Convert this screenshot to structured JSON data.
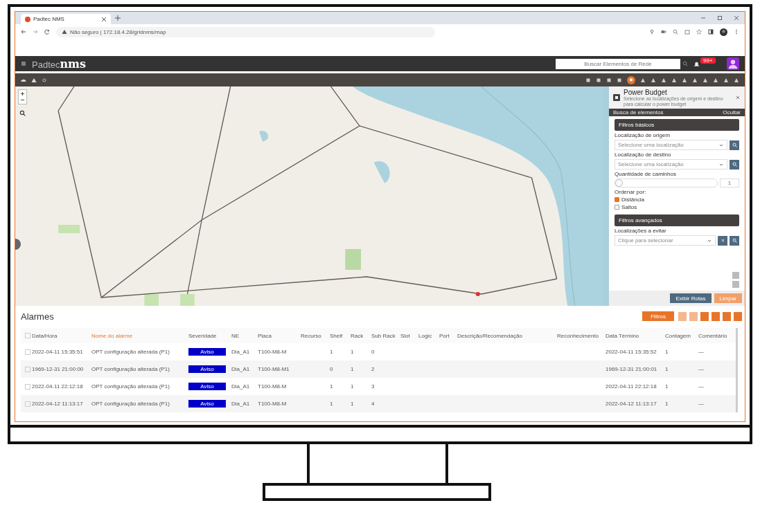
{
  "browser": {
    "tab_title": "Padtec NMS",
    "url": "Não seguro | 172.18.4.28/gridnms/map"
  },
  "header": {
    "logo_brand": "Padtec",
    "logo_product": "nms",
    "search": {
      "placeholder": "Buscar Elementos de Rede"
    },
    "notification_badge": "99+"
  },
  "power_budget": {
    "title": "Power Budget",
    "subtitle": "Selecione as localizações de origem e destino para calcular o power budget",
    "bar_left": "Busca de elementos",
    "bar_right": "Ocultar",
    "basic_title": "Filtros básicos",
    "fields": [
      {
        "label": "Localização de origem",
        "placeholder": "Selecione uma localização",
        "kind": "select"
      },
      {
        "label": "Localização de destino",
        "placeholder": "Selecione uma localização",
        "kind": "select"
      },
      {
        "label": "Quantidade de caminhos",
        "placeholder": "1",
        "kind": "number",
        "level": 0.0
      }
    ],
    "order_label": "Ordenar por:",
    "order_options": [
      {
        "label": "Distância",
        "selected": true
      },
      {
        "label": "Saltos",
        "selected": false
      }
    ],
    "advanced_title": "Filtros avançados",
    "avoid_label": "Localizações a evitar",
    "avoid_placeholder": "Clique para selecionar",
    "buttons": [
      {
        "label": "Exibir Rotas",
        "kind": "primary"
      },
      {
        "label": "Limpar",
        "kind": "secondary"
      }
    ]
  },
  "alarms": {
    "title": "Alarmes",
    "filter_button": "Filtros",
    "select_all_checked": false,
    "columns": [
      {
        "label": "Data/Hora",
        "sorted": false
      },
      {
        "label": "Nome do alarme",
        "sorted": true
      },
      {
        "label": "Severidade",
        "sorted": false
      },
      {
        "label": "NE",
        "sorted": false
      },
      {
        "label": "Placa",
        "sorted": false
      },
      {
        "label": "Recurso",
        "sorted": false
      },
      {
        "label": "Shelf",
        "sorted": false
      },
      {
        "label": "Rack",
        "sorted": false
      },
      {
        "label": "Sub Rack",
        "sorted": false
      },
      {
        "label": "Slot",
        "sorted": false
      },
      {
        "label": "Logic",
        "sorted": false
      },
      {
        "label": "Port",
        "sorted": false
      },
      {
        "label": "Descrição/Recomendação",
        "sorted": false
      },
      {
        "label": "Reconhecimento",
        "sorted": false
      },
      {
        "label": "Data Término",
        "sorted": false
      },
      {
        "label": "Contagem",
        "sorted": false
      },
      {
        "label": "Comentário",
        "sorted": false
      }
    ],
    "rows": [
      {
        "checked": false,
        "cells": [
          "2022-04-11 15:35:51",
          "OPT configuração alterada (P1)",
          "Aviso",
          "Dia_A1",
          "T100-M8-M",
          "",
          "1",
          "1",
          "0",
          "",
          "",
          "",
          "",
          "",
          "2022-04-11 15:35:52",
          "1",
          "—"
        ]
      },
      {
        "checked": false,
        "cells": [
          "1969-12-31 21:00:00",
          "OPT configuração alterada (P1)",
          "Aviso",
          "Dia_A1",
          "T100-M8-M1",
          "",
          "0",
          "1",
          "2",
          "",
          "",
          "",
          "",
          "",
          "1969-12-31 21:00:01",
          "1",
          "—"
        ]
      },
      {
        "checked": false,
        "cells": [
          "2022-04-11 22:12:18",
          "OPT configuração alterada (P1)",
          "Aviso",
          "Dia_A1",
          "T100-M8-M",
          "",
          "1",
          "1",
          "3",
          "",
          "",
          "",
          "",
          "",
          "2022-04-11 22:12:18",
          "1",
          "—"
        ]
      },
      {
        "checked": false,
        "cells": [
          "2022-04-12 11:13:17",
          "OPT configuração alterada (P1)",
          "Aviso",
          "Dia_A1",
          "T100-M8-M",
          "",
          "1",
          "1",
          "4",
          "",
          "",
          "",
          "",
          "",
          "2022-04-12 11:13:17",
          "1",
          "—"
        ]
      }
    ]
  }
}
